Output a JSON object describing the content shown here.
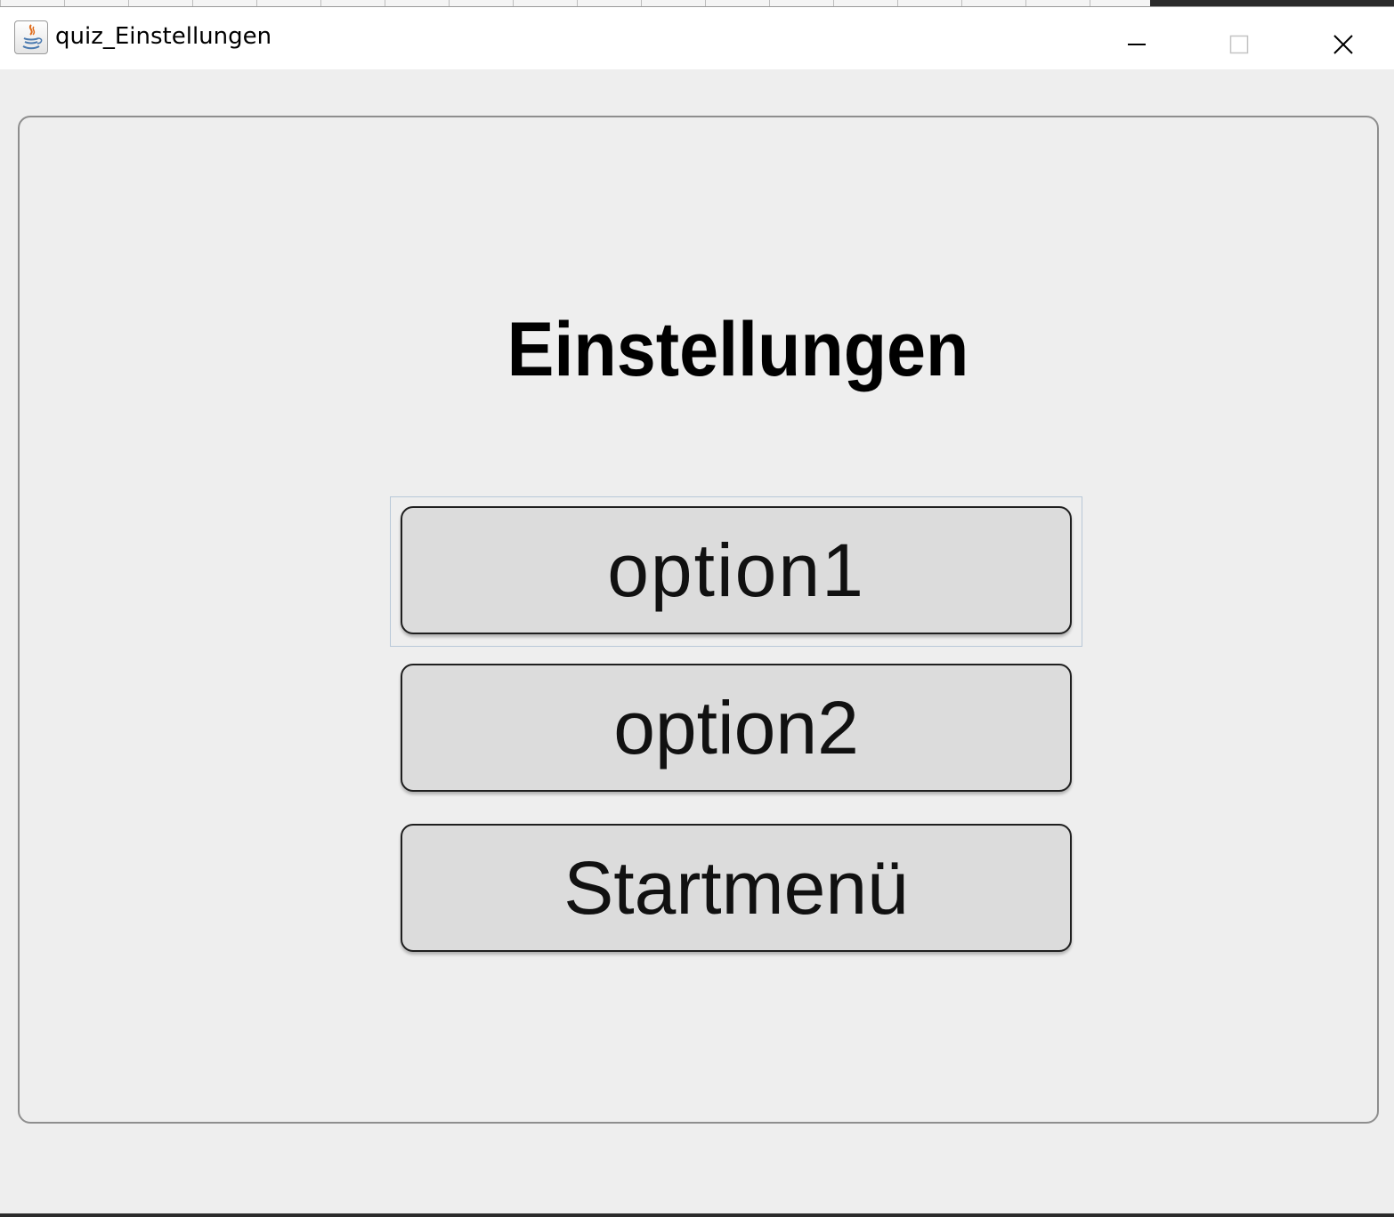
{
  "window": {
    "title": "quiz_Einstellungen",
    "icon": "java-icon"
  },
  "window_controls": {
    "minimize_icon": "minimize-icon",
    "maximize_icon": "maximize-icon",
    "close_icon": "close-icon"
  },
  "content": {
    "heading": "Einstellungen",
    "buttons": [
      {
        "label": "option1",
        "focused": true
      },
      {
        "label": "option2",
        "focused": false
      },
      {
        "label": "Startmenü",
        "focused": false
      }
    ]
  },
  "colors": {
    "background": "#eeeeee",
    "button_face": "#dcdcdc",
    "button_border": "#1f1f1f",
    "focus_ring": "#b8c8d8"
  }
}
